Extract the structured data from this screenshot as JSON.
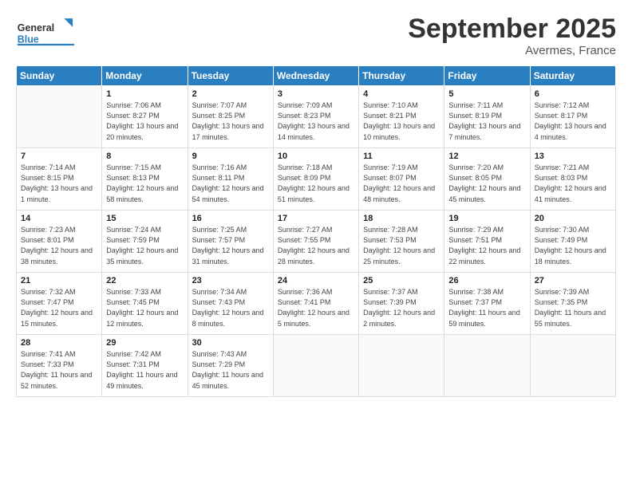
{
  "header": {
    "logo_general": "General",
    "logo_blue": "Blue",
    "month": "September 2025",
    "location": "Avermes, France"
  },
  "days_of_week": [
    "Sunday",
    "Monday",
    "Tuesday",
    "Wednesday",
    "Thursday",
    "Friday",
    "Saturday"
  ],
  "weeks": [
    [
      {
        "day": "",
        "sunrise": "",
        "sunset": "",
        "daylight": ""
      },
      {
        "day": "1",
        "sunrise": "Sunrise: 7:06 AM",
        "sunset": "Sunset: 8:27 PM",
        "daylight": "Daylight: 13 hours and 20 minutes."
      },
      {
        "day": "2",
        "sunrise": "Sunrise: 7:07 AM",
        "sunset": "Sunset: 8:25 PM",
        "daylight": "Daylight: 13 hours and 17 minutes."
      },
      {
        "day": "3",
        "sunrise": "Sunrise: 7:09 AM",
        "sunset": "Sunset: 8:23 PM",
        "daylight": "Daylight: 13 hours and 14 minutes."
      },
      {
        "day": "4",
        "sunrise": "Sunrise: 7:10 AM",
        "sunset": "Sunset: 8:21 PM",
        "daylight": "Daylight: 13 hours and 10 minutes."
      },
      {
        "day": "5",
        "sunrise": "Sunrise: 7:11 AM",
        "sunset": "Sunset: 8:19 PM",
        "daylight": "Daylight: 13 hours and 7 minutes."
      },
      {
        "day": "6",
        "sunrise": "Sunrise: 7:12 AM",
        "sunset": "Sunset: 8:17 PM",
        "daylight": "Daylight: 13 hours and 4 minutes."
      }
    ],
    [
      {
        "day": "7",
        "sunrise": "Sunrise: 7:14 AM",
        "sunset": "Sunset: 8:15 PM",
        "daylight": "Daylight: 13 hours and 1 minute."
      },
      {
        "day": "8",
        "sunrise": "Sunrise: 7:15 AM",
        "sunset": "Sunset: 8:13 PM",
        "daylight": "Daylight: 12 hours and 58 minutes."
      },
      {
        "day": "9",
        "sunrise": "Sunrise: 7:16 AM",
        "sunset": "Sunset: 8:11 PM",
        "daylight": "Daylight: 12 hours and 54 minutes."
      },
      {
        "day": "10",
        "sunrise": "Sunrise: 7:18 AM",
        "sunset": "Sunset: 8:09 PM",
        "daylight": "Daylight: 12 hours and 51 minutes."
      },
      {
        "day": "11",
        "sunrise": "Sunrise: 7:19 AM",
        "sunset": "Sunset: 8:07 PM",
        "daylight": "Daylight: 12 hours and 48 minutes."
      },
      {
        "day": "12",
        "sunrise": "Sunrise: 7:20 AM",
        "sunset": "Sunset: 8:05 PM",
        "daylight": "Daylight: 12 hours and 45 minutes."
      },
      {
        "day": "13",
        "sunrise": "Sunrise: 7:21 AM",
        "sunset": "Sunset: 8:03 PM",
        "daylight": "Daylight: 12 hours and 41 minutes."
      }
    ],
    [
      {
        "day": "14",
        "sunrise": "Sunrise: 7:23 AM",
        "sunset": "Sunset: 8:01 PM",
        "daylight": "Daylight: 12 hours and 38 minutes."
      },
      {
        "day": "15",
        "sunrise": "Sunrise: 7:24 AM",
        "sunset": "Sunset: 7:59 PM",
        "daylight": "Daylight: 12 hours and 35 minutes."
      },
      {
        "day": "16",
        "sunrise": "Sunrise: 7:25 AM",
        "sunset": "Sunset: 7:57 PM",
        "daylight": "Daylight: 12 hours and 31 minutes."
      },
      {
        "day": "17",
        "sunrise": "Sunrise: 7:27 AM",
        "sunset": "Sunset: 7:55 PM",
        "daylight": "Daylight: 12 hours and 28 minutes."
      },
      {
        "day": "18",
        "sunrise": "Sunrise: 7:28 AM",
        "sunset": "Sunset: 7:53 PM",
        "daylight": "Daylight: 12 hours and 25 minutes."
      },
      {
        "day": "19",
        "sunrise": "Sunrise: 7:29 AM",
        "sunset": "Sunset: 7:51 PM",
        "daylight": "Daylight: 12 hours and 22 minutes."
      },
      {
        "day": "20",
        "sunrise": "Sunrise: 7:30 AM",
        "sunset": "Sunset: 7:49 PM",
        "daylight": "Daylight: 12 hours and 18 minutes."
      }
    ],
    [
      {
        "day": "21",
        "sunrise": "Sunrise: 7:32 AM",
        "sunset": "Sunset: 7:47 PM",
        "daylight": "Daylight: 12 hours and 15 minutes."
      },
      {
        "day": "22",
        "sunrise": "Sunrise: 7:33 AM",
        "sunset": "Sunset: 7:45 PM",
        "daylight": "Daylight: 12 hours and 12 minutes."
      },
      {
        "day": "23",
        "sunrise": "Sunrise: 7:34 AM",
        "sunset": "Sunset: 7:43 PM",
        "daylight": "Daylight: 12 hours and 8 minutes."
      },
      {
        "day": "24",
        "sunrise": "Sunrise: 7:36 AM",
        "sunset": "Sunset: 7:41 PM",
        "daylight": "Daylight: 12 hours and 5 minutes."
      },
      {
        "day": "25",
        "sunrise": "Sunrise: 7:37 AM",
        "sunset": "Sunset: 7:39 PM",
        "daylight": "Daylight: 12 hours and 2 minutes."
      },
      {
        "day": "26",
        "sunrise": "Sunrise: 7:38 AM",
        "sunset": "Sunset: 7:37 PM",
        "daylight": "Daylight: 11 hours and 59 minutes."
      },
      {
        "day": "27",
        "sunrise": "Sunrise: 7:39 AM",
        "sunset": "Sunset: 7:35 PM",
        "daylight": "Daylight: 11 hours and 55 minutes."
      }
    ],
    [
      {
        "day": "28",
        "sunrise": "Sunrise: 7:41 AM",
        "sunset": "Sunset: 7:33 PM",
        "daylight": "Daylight: 11 hours and 52 minutes."
      },
      {
        "day": "29",
        "sunrise": "Sunrise: 7:42 AM",
        "sunset": "Sunset: 7:31 PM",
        "daylight": "Daylight: 11 hours and 49 minutes."
      },
      {
        "day": "30",
        "sunrise": "Sunrise: 7:43 AM",
        "sunset": "Sunset: 7:29 PM",
        "daylight": "Daylight: 11 hours and 45 minutes."
      },
      {
        "day": "",
        "sunrise": "",
        "sunset": "",
        "daylight": ""
      },
      {
        "day": "",
        "sunrise": "",
        "sunset": "",
        "daylight": ""
      },
      {
        "day": "",
        "sunrise": "",
        "sunset": "",
        "daylight": ""
      },
      {
        "day": "",
        "sunrise": "",
        "sunset": "",
        "daylight": ""
      }
    ]
  ]
}
